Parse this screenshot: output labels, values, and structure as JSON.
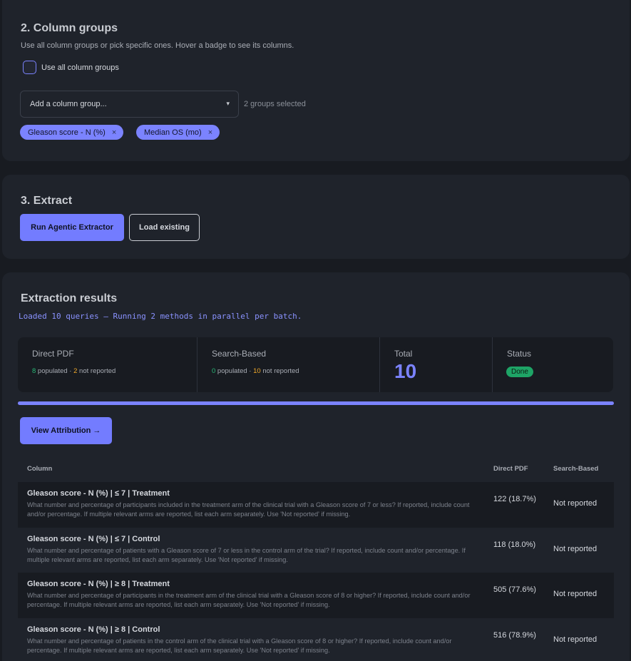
{
  "column_groups": {
    "title": "2. Column groups",
    "subtitle": "Use all column groups or pick specific ones. Hover a badge to see its columns.",
    "use_all_label": "Use all column groups",
    "use_all_checked": false,
    "select_placeholder": "Add a column group...",
    "selected_count": "2 groups selected",
    "chips": [
      "Gleason score - N (%)",
      "Median OS (mo)"
    ],
    "chip_remove": "×"
  },
  "extract": {
    "title": "3. Extract",
    "run_label": "Run Agentic Extractor",
    "load_label": "Load existing"
  },
  "results": {
    "title": "Extraction results",
    "status_line": "Loaded 10 queries — Running 2 methods in parallel per batch.",
    "stats": {
      "direct": {
        "label": "Direct PDF",
        "populated": "8",
        "populated_text": " populated · ",
        "not_reported": "2",
        "not_reported_text": " not reported"
      },
      "search": {
        "label": "Search-Based",
        "populated": "0",
        "populated_text": " populated · ",
        "not_reported": "10",
        "not_reported_text": " not reported"
      },
      "total": {
        "label": "Total",
        "value": "10"
      },
      "status": {
        "label": "Status",
        "value": "Done"
      }
    },
    "progress": 1.0,
    "view_attribution_label": "View Attribution →",
    "table": {
      "headers": [
        "Column",
        "Direct PDF",
        "Search-Based"
      ],
      "rows": [
        {
          "title": "Gleason score - N (%) | ≤ 7 | Treatment",
          "description": "What number and percentage of participants included in the treatment arm of the clinical trial with a Gleason score of 7 or less? If reported, include count and/or percentage. If multiple relevant arms are reported, list each arm separately. Use 'Not reported' if missing.",
          "direct": "122 (18.7%)",
          "search": "Not reported"
        },
        {
          "title": "Gleason score - N (%) | ≤ 7 | Control",
          "description": "What number and percentage of patients with a Gleason score of 7 or less in the control arm of the trial? If reported, include count and/or percentage. If multiple relevant arms are reported, list each arm separately. Use 'Not reported' if missing.",
          "direct": "118 (18.0%)",
          "search": "Not reported"
        },
        {
          "title": "Gleason score - N (%) | ≥ 8 | Treatment",
          "description": "What number and percentage of participants in the treatment arm of the clinical trial with a Gleason score of 8 or higher? If reported, include count and/or percentage. If multiple relevant arms are reported, list each arm separately. Use 'Not reported' if missing.",
          "direct": "505 (77.6%)",
          "search": "Not reported"
        },
        {
          "title": "Gleason score - N (%) | ≥ 8 | Control",
          "description": "What number and percentage of patients in the control arm of the clinical trial with a Gleason score of 8 or higher? If reported, include count and/or percentage. If multiple relevant arms are reported, list each arm separately. Use 'Not reported' if missing.",
          "direct": "516 (78.9%)",
          "search": "Not reported"
        }
      ]
    }
  },
  "colors": {
    "accent": "#7b83ff",
    "success": "#1ea466",
    "warning": "#f0a92b",
    "background": "#181b21",
    "card": "#1f232b"
  },
  "icons": {
    "select_chevron": "chevron-down-icon",
    "chip_remove": "close-icon"
  }
}
